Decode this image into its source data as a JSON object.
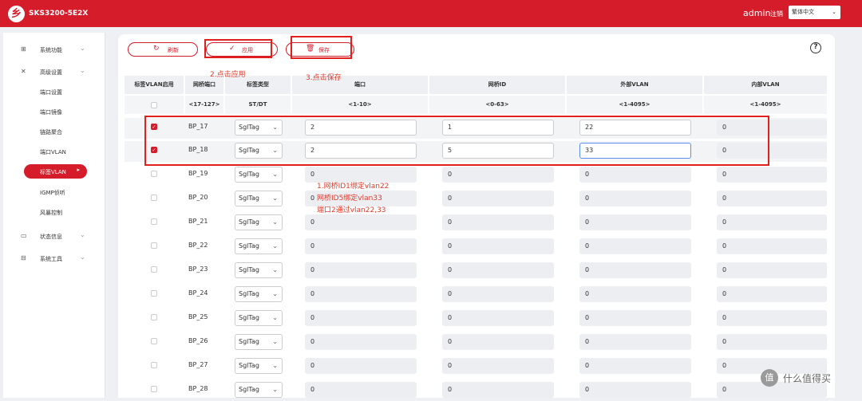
{
  "header": {
    "logo_glyph": "乡",
    "model": "SKS3200-5E2X",
    "user": "admin",
    "logout": "注销",
    "language": "繁体中文"
  },
  "sidebar": {
    "menus": [
      {
        "icon": "grid-icon",
        "glyph": "⊞",
        "label": "系统功能"
      },
      {
        "icon": "tools-icon",
        "glyph": "✕",
        "label": "高级设置"
      },
      {
        "icon": "monitor-icon",
        "glyph": "▭",
        "label": "状态信息"
      },
      {
        "icon": "toolbox-icon",
        "glyph": "⊟",
        "label": "系统工具"
      }
    ],
    "sub_items": [
      "端口设置",
      "端口镜像",
      "链路聚合",
      "端口VLAN",
      "标签VLAN",
      "IGMP侦听",
      "风暴控制"
    ],
    "active_item": "标签VLAN"
  },
  "toolbar": {
    "refresh": "刷新",
    "apply": "应用",
    "save": "保存",
    "help": "?"
  },
  "annotations": {
    "apply_step": "2.点击应用",
    "save_step": "3.点击保存",
    "note_line1": "1.网桥ID1绑定vlan22",
    "note_line2": "网桥ID5绑定vlan33",
    "note_line3": "端口2通过vlan22,33"
  },
  "table": {
    "headers": [
      "标签VLAN启用",
      "网桥端口",
      "标签类型",
      "端口",
      "网桥ID",
      "外部VLAN",
      "内部VLAN"
    ],
    "ranges": [
      "",
      "<17-127>",
      "ST/DT",
      "<1-10>",
      "<0-63>",
      "<1-4095>",
      "<1-4095>"
    ],
    "rows": [
      {
        "enabled": true,
        "port": "BP_17",
        "type": "SglTag",
        "port_no": "2",
        "bridge_id": "1",
        "outer_vlan": "22",
        "inner_vlan": "0"
      },
      {
        "enabled": true,
        "port": "BP_18",
        "type": "SglTag",
        "port_no": "2",
        "bridge_id": "5",
        "outer_vlan": "33",
        "inner_vlan": "0"
      },
      {
        "enabled": false,
        "port": "BP_19",
        "type": "SglTag",
        "port_no": "0",
        "bridge_id": "0",
        "outer_vlan": "0",
        "inner_vlan": "0"
      },
      {
        "enabled": false,
        "port": "BP_20",
        "type": "SglTag",
        "port_no": "0",
        "bridge_id": "0",
        "outer_vlan": "0",
        "inner_vlan": "0"
      },
      {
        "enabled": false,
        "port": "BP_21",
        "type": "SglTag",
        "port_no": "0",
        "bridge_id": "0",
        "outer_vlan": "0",
        "inner_vlan": "0"
      },
      {
        "enabled": false,
        "port": "BP_22",
        "type": "SglTag",
        "port_no": "0",
        "bridge_id": "0",
        "outer_vlan": "0",
        "inner_vlan": "0"
      },
      {
        "enabled": false,
        "port": "BP_23",
        "type": "SglTag",
        "port_no": "0",
        "bridge_id": "0",
        "outer_vlan": "0",
        "inner_vlan": "0"
      },
      {
        "enabled": false,
        "port": "BP_24",
        "type": "SglTag",
        "port_no": "0",
        "bridge_id": "0",
        "outer_vlan": "0",
        "inner_vlan": "0"
      },
      {
        "enabled": false,
        "port": "BP_25",
        "type": "SglTag",
        "port_no": "0",
        "bridge_id": "0",
        "outer_vlan": "0",
        "inner_vlan": "0"
      },
      {
        "enabled": false,
        "port": "BP_26",
        "type": "SglTag",
        "port_no": "0",
        "bridge_id": "0",
        "outer_vlan": "0",
        "inner_vlan": "0"
      },
      {
        "enabled": false,
        "port": "BP_27",
        "type": "SglTag",
        "port_no": "0",
        "bridge_id": "0",
        "outer_vlan": "0",
        "inner_vlan": "0"
      },
      {
        "enabled": false,
        "port": "BP_28",
        "type": "SglTag",
        "port_no": "0",
        "bridge_id": "0",
        "outer_vlan": "0",
        "inner_vlan": "0"
      }
    ]
  },
  "watermark": {
    "glyph": "值",
    "text": "什么值得买"
  },
  "colors": {
    "brand": "#d51c2a",
    "annotation": "#e23b2c"
  }
}
